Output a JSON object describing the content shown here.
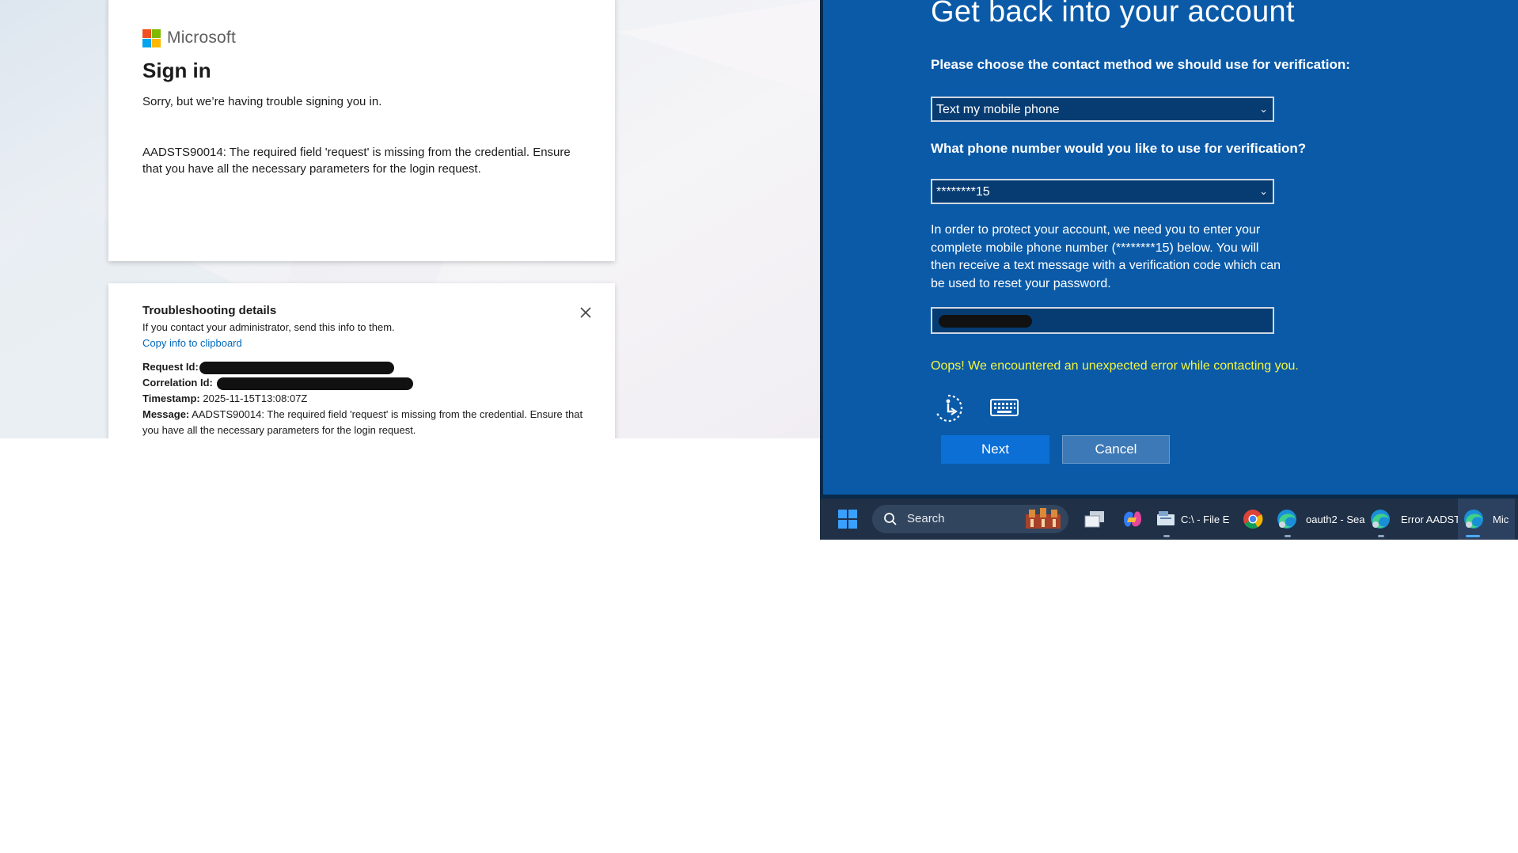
{
  "signin": {
    "brand": "Microsoft",
    "title": "Sign in",
    "message": "Sorry, but we’re having trouble signing you in.",
    "error": "AADSTS90014: The required field 'request' is missing from the credential. Ensure that you have all the necessary parameters for the login request."
  },
  "troubleshooting": {
    "title": "Troubleshooting details",
    "subtitle": "If you contact your administrator, send this info to them.",
    "copy_link": "Copy info to clipboard",
    "request_id_label": "Request Id:",
    "correlation_id_label": "Correlation Id:",
    "timestamp_label": "Timestamp:",
    "timestamp_value": "2025-11-15T13:08:07Z",
    "message_label": "Message:",
    "message_value": "AADSTS90014: The required field 'request' is missing from the credential. Ensure that you have all the necessary parameters for the login request."
  },
  "recovery": {
    "title": "Get back into your account",
    "contact_label": "Please choose the contact method we should use for verification:",
    "contact_selected": "Text my mobile phone",
    "phone_label": "What phone number would you like to use for verification?",
    "phone_selected": "********15",
    "instructions": "In order to protect your account, we need you to enter your complete mobile phone number (********15) below. You will then receive a text message with a verification code which can be used to reset your password.",
    "error": "Oops! We encountered an unexpected error while contacting you.",
    "next_label": "Next",
    "cancel_label": "Cancel",
    "icons": [
      "accessibility-icon",
      "keyboard-icon"
    ]
  },
  "taskbar": {
    "search_label": "Search",
    "items": [
      {
        "icon": "windows-start-icon"
      },
      {
        "icon": "task-view-icon"
      },
      {
        "icon": "copilot-icon"
      },
      {
        "label": "C:\\ - File E",
        "icon": "file-explorer-icon"
      },
      {
        "icon": "chrome-icon"
      },
      {
        "label": "oauth2 - Sea",
        "icon": "edge-icon"
      },
      {
        "label": "Error AADST",
        "icon": "edge-icon"
      },
      {
        "label": "Mic",
        "icon": "edge-icon"
      }
    ]
  },
  "colors": {
    "ms_red": "#f25022",
    "ms_green": "#7fba00",
    "ms_blue": "#00a4ef",
    "ms_yellow": "#ffb900",
    "recovery_blue": "#0a5aa8",
    "error_yellow": "#f3f542",
    "link_blue": "#0067b8"
  }
}
